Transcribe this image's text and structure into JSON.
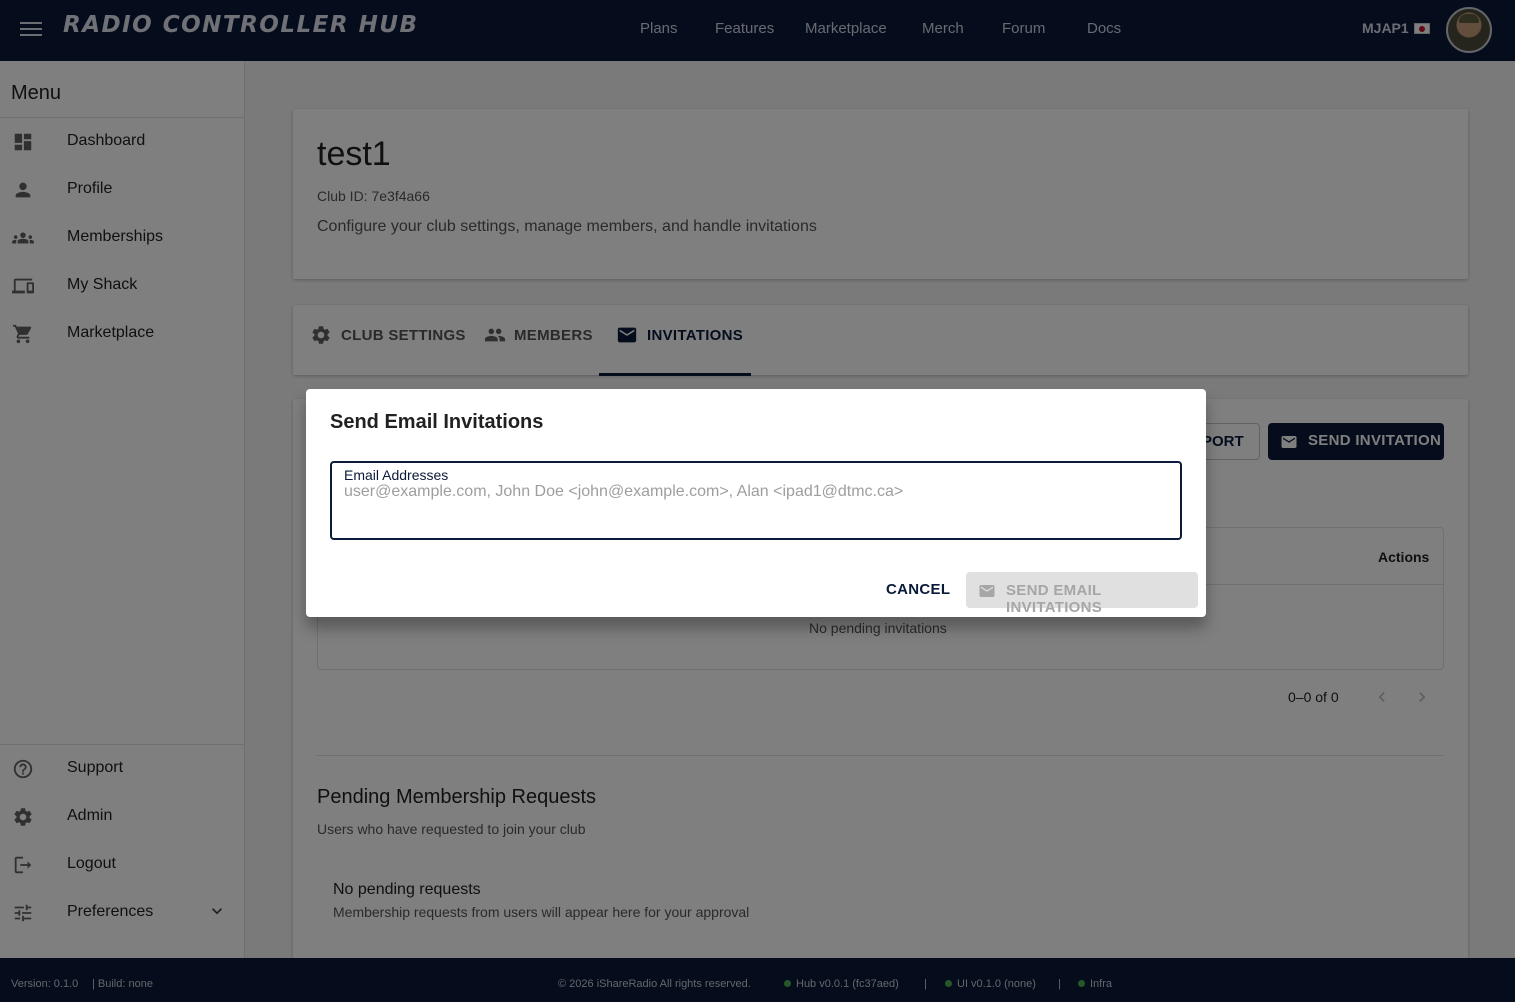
{
  "topbar": {
    "brand": "RADIO CONTROLLER HUB",
    "nav": [
      "Plans",
      "Features",
      "Marketplace",
      "Merch",
      "Forum",
      "Docs"
    ],
    "user": "MJAP1"
  },
  "sidebar": {
    "title": "Menu",
    "items": [
      {
        "label": "Dashboard",
        "icon": "dashboard-icon"
      },
      {
        "label": "Profile",
        "icon": "person-icon"
      },
      {
        "label": "Memberships",
        "icon": "group-icon"
      },
      {
        "label": "My Shack",
        "icon": "devices-icon"
      },
      {
        "label": "Marketplace",
        "icon": "cart-icon"
      }
    ],
    "bottom_items": [
      {
        "label": "Support",
        "icon": "help-icon"
      },
      {
        "label": "Admin",
        "icon": "gear-icon"
      },
      {
        "label": "Logout",
        "icon": "logout-icon"
      },
      {
        "label": "Preferences",
        "icon": "tune-icon"
      }
    ]
  },
  "club": {
    "name": "test1",
    "id_line": "Club ID: 7e3f4a66",
    "description": "Configure your club settings, manage members, and handle invitations"
  },
  "tabs": [
    {
      "label": "CLUB SETTINGS",
      "icon": "gear-icon"
    },
    {
      "label": "MEMBERS",
      "icon": "group-icon"
    },
    {
      "label": "INVITATIONS",
      "icon": "mail-icon",
      "active": true
    }
  ],
  "invitations": {
    "export_label_partial": "PORT",
    "send_invitation_label": "SEND INVITATION",
    "actions_header": "Actions",
    "empty_text": "No pending invitations",
    "pagination": "0–0 of 0"
  },
  "pending": {
    "title": "Pending Membership Requests",
    "subtitle": "Users who have requested to join your club",
    "empty_title": "No pending requests",
    "empty_sub": "Membership requests from users will appear here for your approval"
  },
  "dialog": {
    "title": "Send Email Invitations",
    "field_label": "Email Addresses",
    "field_value": "",
    "placeholder": "user@example.com, John Doe <john@example.com>, Alan <ipad1@dtmc.ca>",
    "cancel_label": "CANCEL",
    "submit_label": "SEND EMAIL INVITATIONS"
  },
  "footer": {
    "version": "Version: 0.1.0",
    "build": "| Build: none",
    "copyright": "© 2026 iShareRadio All rights reserved.",
    "hub": "Hub v0.0.1 (fc37aed)",
    "ui": "UI v0.1.0 (none)",
    "infra": "Infra",
    "separator": "|",
    "status_color": "#4caf50"
  },
  "colors": {
    "primary": "#0a1a3a",
    "background": "#f5f5f5"
  }
}
